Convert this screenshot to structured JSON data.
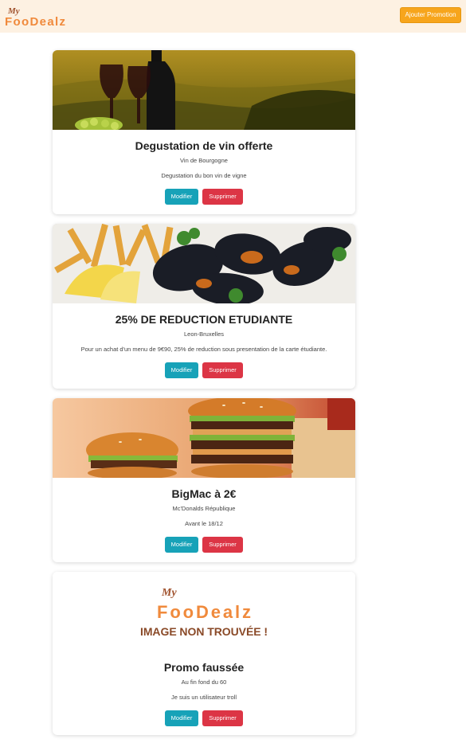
{
  "header": {
    "logo": {
      "line1": "My",
      "line2": "FooDealz"
    },
    "add_button": "Ajouter Promotion"
  },
  "cards": [
    {
      "image": "wine-tasting-photo",
      "title": "Degustation de vin offerte",
      "subtitle": "Vin de Bourgogne",
      "description": "Degustation du bon vin de vigne",
      "edit_label": "Modifier",
      "delete_label": "Supprimer"
    },
    {
      "image": "mussels-fries-photo",
      "title": "25% DE REDUCTION ETUDIANTE",
      "subtitle": "Leon-Bruxelles",
      "description": "Pour un achat d'un menu de 9€90, 25% de reduction sous presentation de la carte étudiante.",
      "edit_label": "Modifier",
      "delete_label": "Supprimer"
    },
    {
      "image": "bigmac-burger-photo",
      "title": "BigMac à 2€",
      "subtitle": "Mc'Donalds République",
      "description": "Avant le 18/12",
      "edit_label": "Modifier",
      "delete_label": "Supprimer"
    },
    {
      "image": "image-not-found-placeholder",
      "placeholder": {
        "line1": "My",
        "line2": "FooDealz",
        "line3": "IMAGE NON TROUVÉE !"
      },
      "title": "Promo faussée",
      "subtitle": "Au fin fond du 60",
      "description": "Je suis un utilisateur troll",
      "edit_label": "Modifier",
      "delete_label": "Supprimer"
    }
  ],
  "colors": {
    "header_bg": "#fdf1e2",
    "accent_orange": "#f7a51c",
    "logo_brown": "#a0522d",
    "logo_orange": "#f08a3c",
    "edit_button": "#17a2b8",
    "delete_button": "#dc3545"
  }
}
